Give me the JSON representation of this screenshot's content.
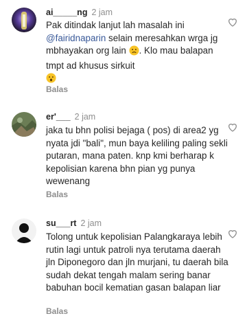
{
  "comments": [
    {
      "username": "ai_____ng",
      "time": "2 jam",
      "text_1": "Pak ditindak lanjut lah masalah ini ",
      "mention": "@fairidnaparin",
      "text_2": " selain meresahkan wrga jg mbhayakan org lain ",
      "text_3": ". Klo mau balapan tmpt ad khusus sirkuit",
      "emoji_1": "worried-face-icon",
      "emoji_2": "hushed-face-icon",
      "reply_label": "Balas"
    },
    {
      "username": "er'___",
      "time": "2 jam",
      "text": "jaka tu bhn polisi bejaga ( pos) di area2 yg nyata jdi \"bali\", mun baya keliling paling sekli putaran, mana paten.  knp kmi  berharap k kepolisian karena bhn pian yg punya wewenang",
      "reply_label": "Balas"
    },
    {
      "username": "su___rt",
      "time": "2 jam",
      "text": "Tolong untuk kepolisian Palangkaraya lebih rutin lagi untuk patroli nya terutama daerah jln Diponegoro dan jln murjani, tu daerah bila sudah dekat tengah malam sering banar babuhan bocil kematian gasan balapan liar",
      "reply_label": "Balas"
    }
  ]
}
